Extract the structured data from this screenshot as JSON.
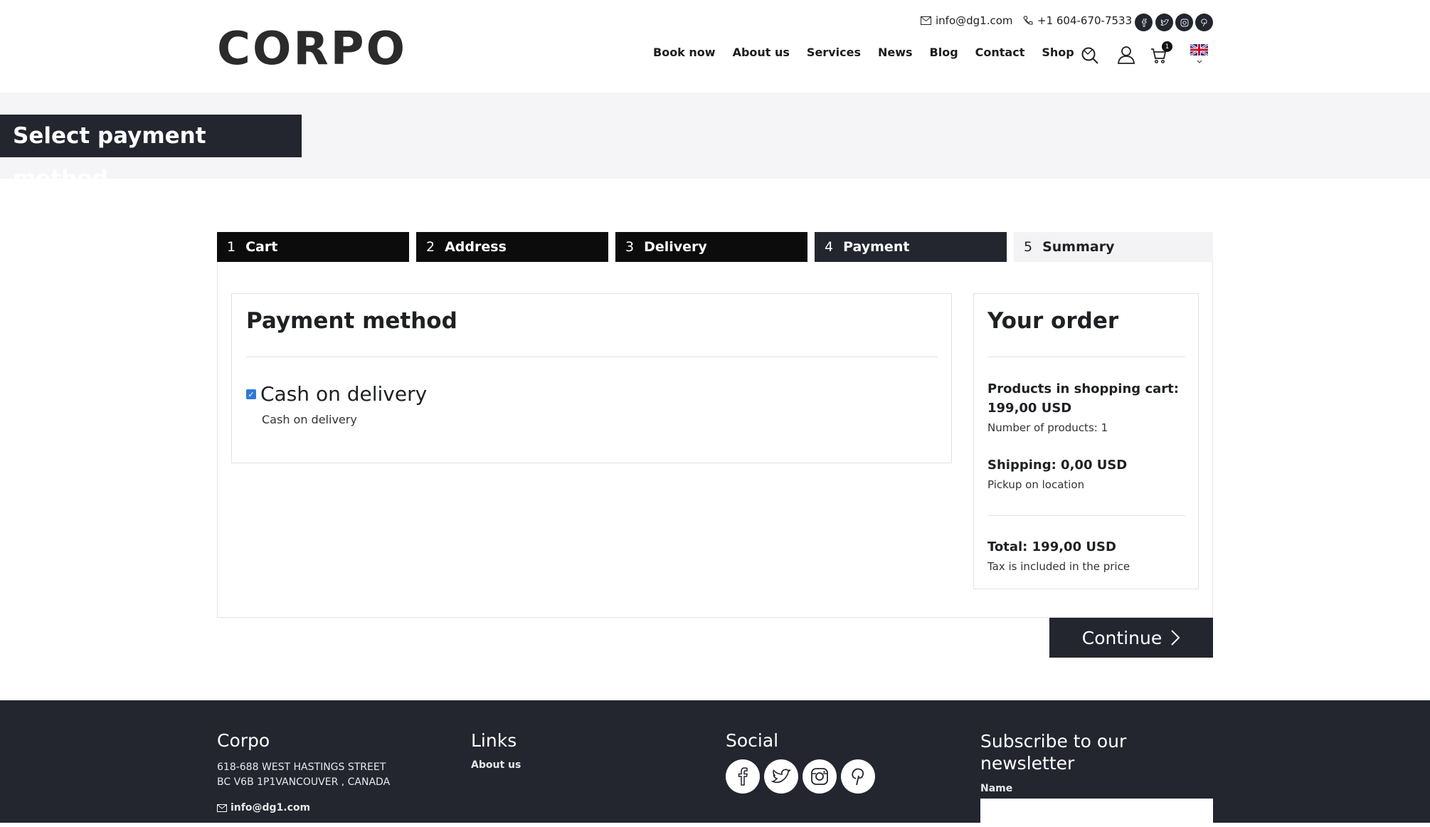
{
  "header": {
    "logo": "CORPO",
    "email": "info@dg1.com",
    "phone": "+1 604-670-7533",
    "nav": [
      "Book now",
      "About us",
      "Services",
      "News",
      "Blog",
      "Contact",
      "Shop"
    ],
    "cart_count": "1"
  },
  "banner": {
    "title": "Select payment method"
  },
  "steps": [
    {
      "num": "1",
      "label": "Cart"
    },
    {
      "num": "2",
      "label": "Address"
    },
    {
      "num": "3",
      "label": "Delivery"
    },
    {
      "num": "4",
      "label": "Payment"
    },
    {
      "num": "5",
      "label": "Summary"
    }
  ],
  "payment": {
    "title": "Payment method",
    "option_label": "Cash on delivery",
    "option_desc": "Cash on delivery",
    "checked": true
  },
  "order": {
    "title": "Your order",
    "products_line": "Products in shopping cart: 199,00 USD",
    "products_count": "Number of products: 1",
    "shipping_line": "Shipping: 0,00 USD",
    "shipping_method": "Pickup on location",
    "total_line": "Total: 199,00 USD",
    "tax_note": "Tax is included in the price"
  },
  "continue_label": "Continue",
  "footer": {
    "col1_title": "Corpo",
    "address_line1": "618-688 WEST HASTINGS STREET",
    "address_line2": "BC V6B 1P1VANCOUVER , CANADA",
    "email": "info@dg1.com",
    "col2_title": "Links",
    "link1": "About us",
    "col3_title": "Social",
    "col4_title_line1": "Subscribe to our",
    "col4_title_line2": "newsletter",
    "name_label": "Name"
  },
  "colors": {
    "dark": "#23252f",
    "black": "#0c0c0c",
    "checkbox": "#2e7bd6"
  }
}
